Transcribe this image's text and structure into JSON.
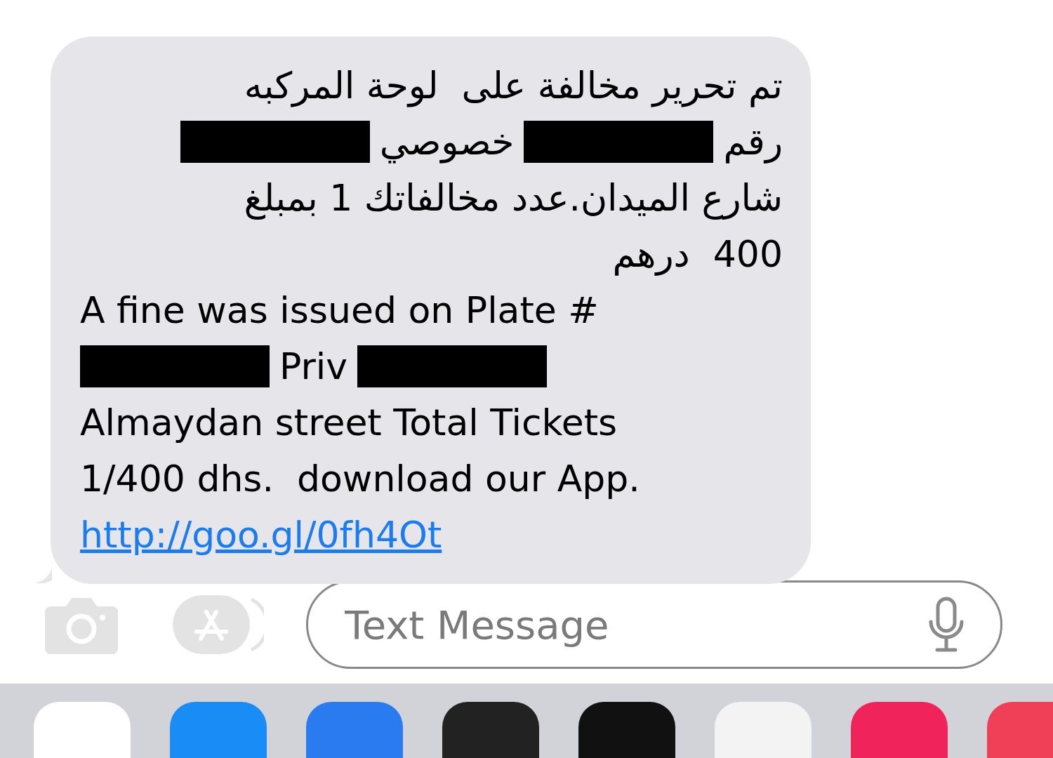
{
  "message": {
    "arabic_lines": [
      [
        {
          "kind": "text",
          "text": "تم تحرير مخالفة على  لوحة المركبه"
        }
      ],
      [
        {
          "kind": "text",
          "text": "رقم"
        },
        {
          "kind": "redaction"
        },
        {
          "kind": "text",
          "text": "خصوصي"
        },
        {
          "kind": "redaction"
        }
      ],
      [
        {
          "kind": "text",
          "text": "شارع الميدان.عدد مخالفاتك 1 بمبلغ"
        }
      ],
      [
        {
          "kind": "text",
          "text": "400  درهم"
        }
      ]
    ],
    "english_lines": [
      [
        {
          "kind": "text",
          "text": "A fine was issued on Plate #"
        }
      ],
      [
        {
          "kind": "redaction"
        },
        {
          "kind": "text",
          "text": "Priv"
        },
        {
          "kind": "redaction"
        }
      ],
      [
        {
          "kind": "text",
          "text": "Almaydan street Total Tickets"
        }
      ],
      [
        {
          "kind": "text",
          "text": "1/400 dhs.  download our App."
        }
      ],
      [
        {
          "kind": "link",
          "text": "http://goo.gl/0fh4Ot"
        }
      ]
    ]
  },
  "composer": {
    "placeholder": "Text Message"
  }
}
